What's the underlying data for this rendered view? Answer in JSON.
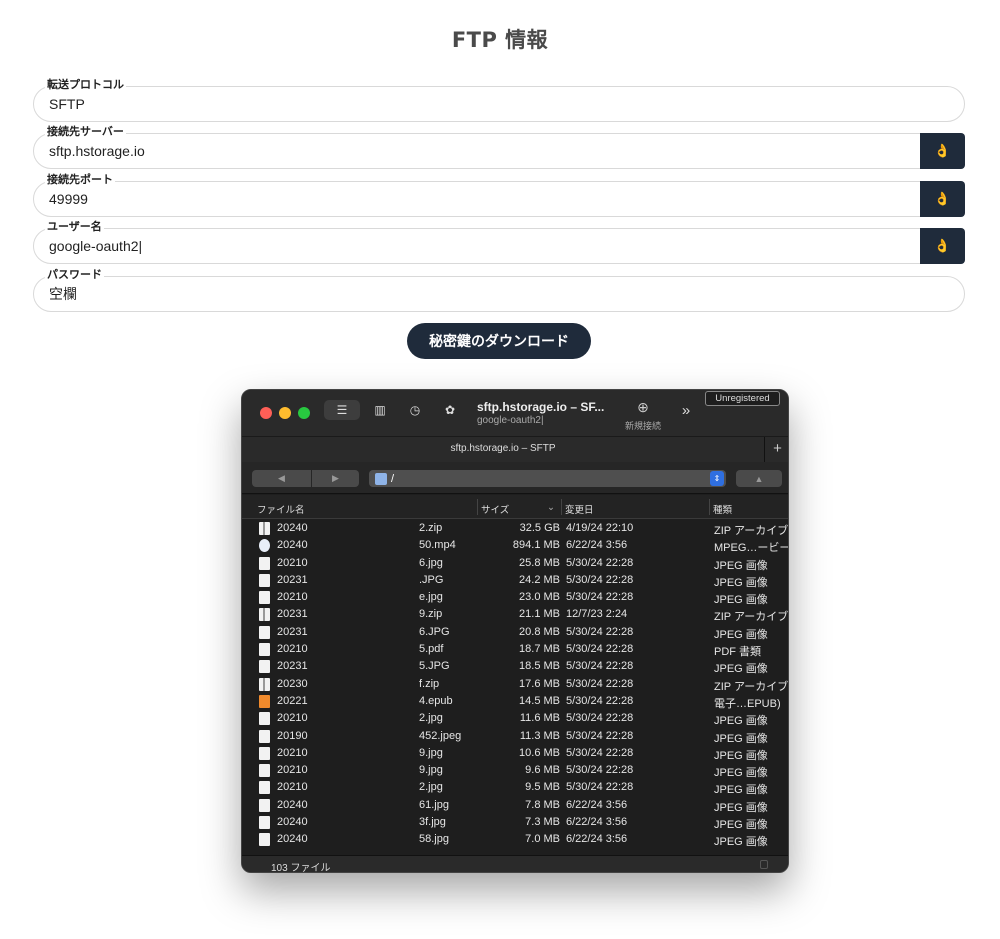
{
  "title": "FTP 情報",
  "fields": [
    {
      "label": "転送プロトコル",
      "value": "SFTP"
    },
    {
      "label": "接続先サーバー",
      "value": "sftp.hstorage.io",
      "button": "👌"
    },
    {
      "label": "接続先ポート",
      "value": "49999",
      "button": "👌"
    },
    {
      "label": "ユーザー名",
      "value": "google-oauth2|",
      "button": "👌"
    },
    {
      "label": "パスワード",
      "value": "空欄"
    }
  ],
  "download_button": "秘密鍵のダウンロード",
  "window": {
    "title": "sftp.hstorage.io – SF...",
    "subtitle": "google-oauth2|",
    "new_connection": "新規接続",
    "unregistered": "Unregistered",
    "tab_title": "sftp.hstorage.io – SFTP",
    "path": "/",
    "columns": {
      "name": "ファイル名",
      "size": "サイズ",
      "modified": "変更日",
      "kind": "種類"
    },
    "files": [
      {
        "name_start": "20240",
        "name_end": "2.zip",
        "size": "32.5 GB",
        "date": "4/19/24 22:10",
        "kind": "ZIP アーカイブ",
        "icon": "zip-icon"
      },
      {
        "name_start": "20240",
        "name_end": "50.mp4",
        "size": "894.1 MB",
        "date": "6/22/24 3:56",
        "kind": "MPEG…ービー",
        "icon": "movie-icon"
      },
      {
        "name_start": "20210",
        "name_end": "6.jpg",
        "size": "25.8 MB",
        "date": "5/30/24 22:28",
        "kind": "JPEG 画像",
        "icon": "image-icon"
      },
      {
        "name_start": "20231",
        "name_end": ".JPG",
        "size": "24.2 MB",
        "date": "5/30/24 22:28",
        "kind": "JPEG 画像",
        "icon": "image-icon"
      },
      {
        "name_start": "20210",
        "name_end": "e.jpg",
        "size": "23.0 MB",
        "date": "5/30/24 22:28",
        "kind": "JPEG 画像",
        "icon": "image-icon"
      },
      {
        "name_start": "20231",
        "name_end": "9.zip",
        "size": "21.1 MB",
        "date": "12/7/23 2:24",
        "kind": "ZIP アーカイブ",
        "icon": "zip-icon"
      },
      {
        "name_start": "20231",
        "name_end": "6.JPG",
        "size": "20.8 MB",
        "date": "5/30/24 22:28",
        "kind": "JPEG 画像",
        "icon": "image-icon"
      },
      {
        "name_start": "20210",
        "name_end": "5.pdf",
        "size": "18.7 MB",
        "date": "5/30/24 22:28",
        "kind": "PDF 書類",
        "icon": "pdf-icon"
      },
      {
        "name_start": "20231",
        "name_end": "5.JPG",
        "size": "18.5 MB",
        "date": "5/30/24 22:28",
        "kind": "JPEG 画像",
        "icon": "image-icon"
      },
      {
        "name_start": "20230",
        "name_end": "f.zip",
        "size": "17.6 MB",
        "date": "5/30/24 22:28",
        "kind": "ZIP アーカイブ",
        "icon": "zip-icon"
      },
      {
        "name_start": "20221",
        "name_end": "4.epub",
        "size": "14.5 MB",
        "date": "5/30/24 22:28",
        "kind": "電子…EPUB)",
        "icon": "epub-icon"
      },
      {
        "name_start": "20210",
        "name_end": "2.jpg",
        "size": "11.6 MB",
        "date": "5/30/24 22:28",
        "kind": "JPEG 画像",
        "icon": "image-icon"
      },
      {
        "name_start": "20190",
        "name_end": "452.jpeg",
        "size": "11.3 MB",
        "date": "5/30/24 22:28",
        "kind": "JPEG 画像",
        "icon": "image-icon"
      },
      {
        "name_start": "20210",
        "name_end": "9.jpg",
        "size": "10.6 MB",
        "date": "5/30/24 22:28",
        "kind": "JPEG 画像",
        "icon": "image-icon"
      },
      {
        "name_start": "20210",
        "name_end": "9.jpg",
        "size": "9.6 MB",
        "date": "5/30/24 22:28",
        "kind": "JPEG 画像",
        "icon": "image-icon"
      },
      {
        "name_start": "20210",
        "name_end": "2.jpg",
        "size": "9.5 MB",
        "date": "5/30/24 22:28",
        "kind": "JPEG 画像",
        "icon": "image-icon"
      },
      {
        "name_start": "20240",
        "name_end": "61.jpg",
        "size": "7.8 MB",
        "date": "6/22/24 3:56",
        "kind": "JPEG 画像",
        "icon": "image-icon"
      },
      {
        "name_start": "20240",
        "name_end": "3f.jpg",
        "size": "7.3 MB",
        "date": "6/22/24 3:56",
        "kind": "JPEG 画像",
        "icon": "image-icon"
      },
      {
        "name_start": "20240",
        "name_end": "58.jpg",
        "size": "7.0 MB",
        "date": "6/22/24 3:56",
        "kind": "JPEG 画像",
        "icon": "image-icon"
      }
    ],
    "status": "103 ファイル"
  }
}
